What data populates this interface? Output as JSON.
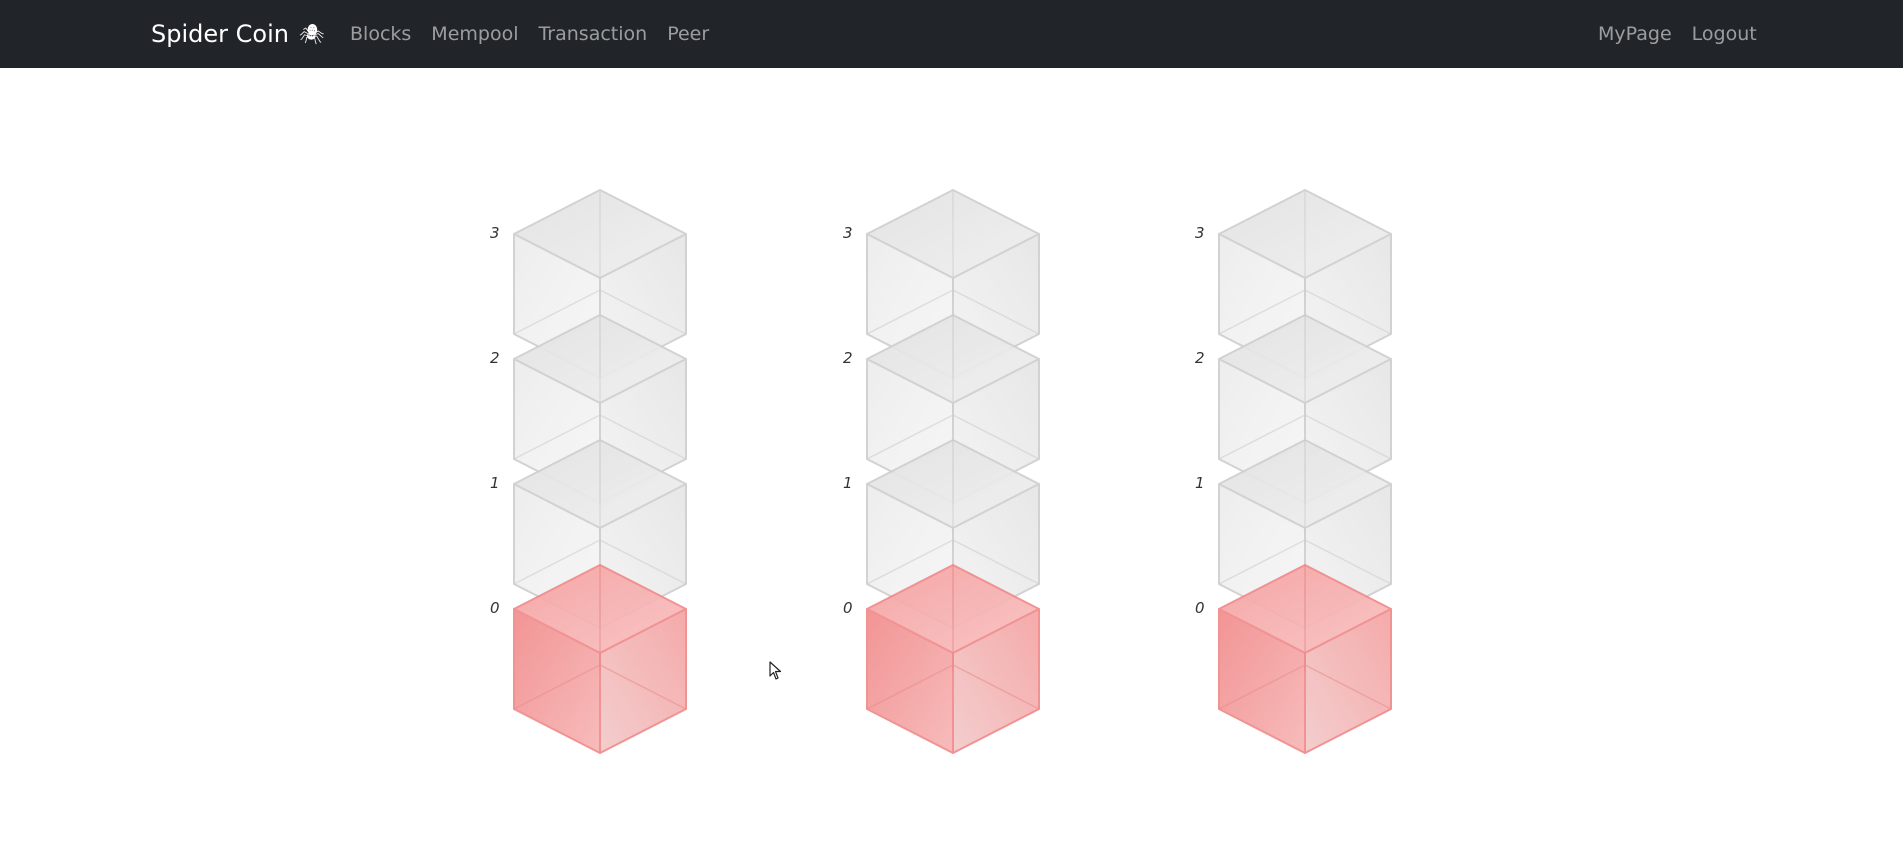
{
  "navbar": {
    "brand": "Spider Coin",
    "brand_icon": "spider-icon",
    "links": [
      "Blocks",
      "Mempool",
      "Transaction",
      "Peer"
    ],
    "right_links": [
      "MyPage",
      "Logout"
    ]
  },
  "chains": [
    {
      "blocks": [
        {
          "height": "3",
          "state": "pending"
        },
        {
          "height": "2",
          "state": "pending"
        },
        {
          "height": "1",
          "state": "pending"
        },
        {
          "height": "0",
          "state": "mined"
        }
      ]
    },
    {
      "blocks": [
        {
          "height": "3",
          "state": "pending"
        },
        {
          "height": "2",
          "state": "pending"
        },
        {
          "height": "1",
          "state": "pending"
        },
        {
          "height": "0",
          "state": "mined"
        }
      ]
    },
    {
      "blocks": [
        {
          "height": "3",
          "state": "pending"
        },
        {
          "height": "2",
          "state": "pending"
        },
        {
          "height": "1",
          "state": "pending"
        },
        {
          "height": "0",
          "state": "mined"
        }
      ]
    }
  ],
  "colors": {
    "navbar_bg": "#212529",
    "pending_block": "#dcdcdc",
    "mined_block": "#f07b7b"
  }
}
